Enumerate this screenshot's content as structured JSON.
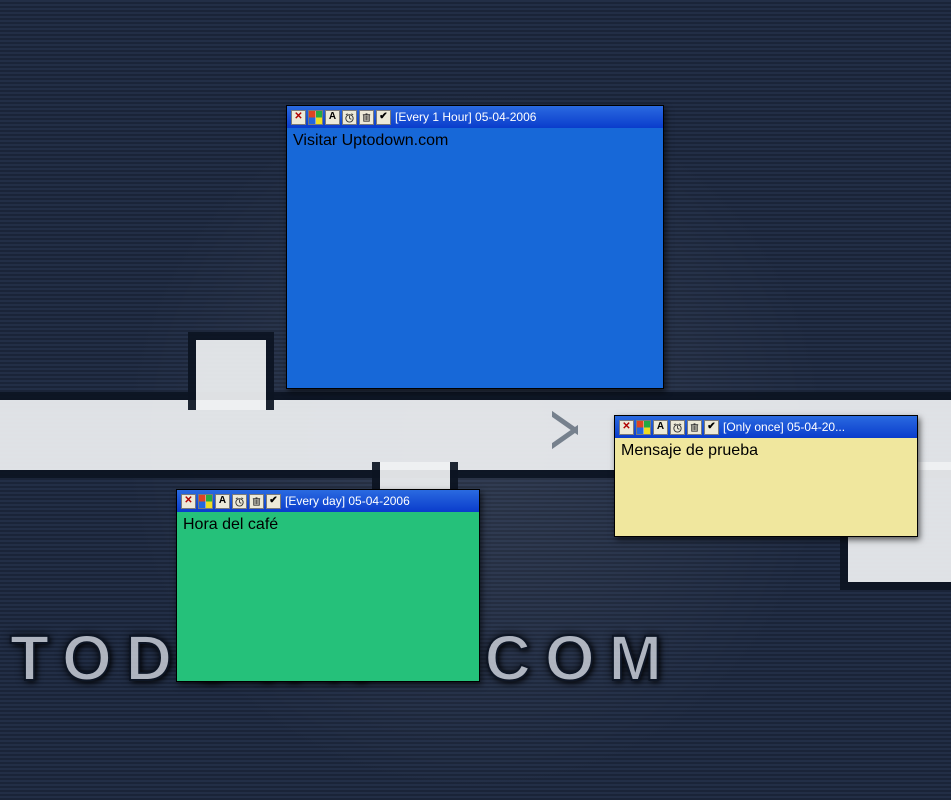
{
  "wallpaper": {
    "brand_text": "TODOWN ▪ COM"
  },
  "notes": {
    "blue": {
      "frequency": "[Every 1 Hour]",
      "date": "05-04-2006",
      "content": "Visitar Uptodown.com"
    },
    "green": {
      "frequency": "[Every day]",
      "date": "05-04-2006",
      "content": "Hora del café"
    },
    "yellow": {
      "frequency": "[Only once]",
      "date": "05-04-20...",
      "content": "Mensaje de prueba"
    }
  },
  "icons": {
    "close_glyph": "✕",
    "font_glyph": "A",
    "check_glyph": "✔"
  }
}
